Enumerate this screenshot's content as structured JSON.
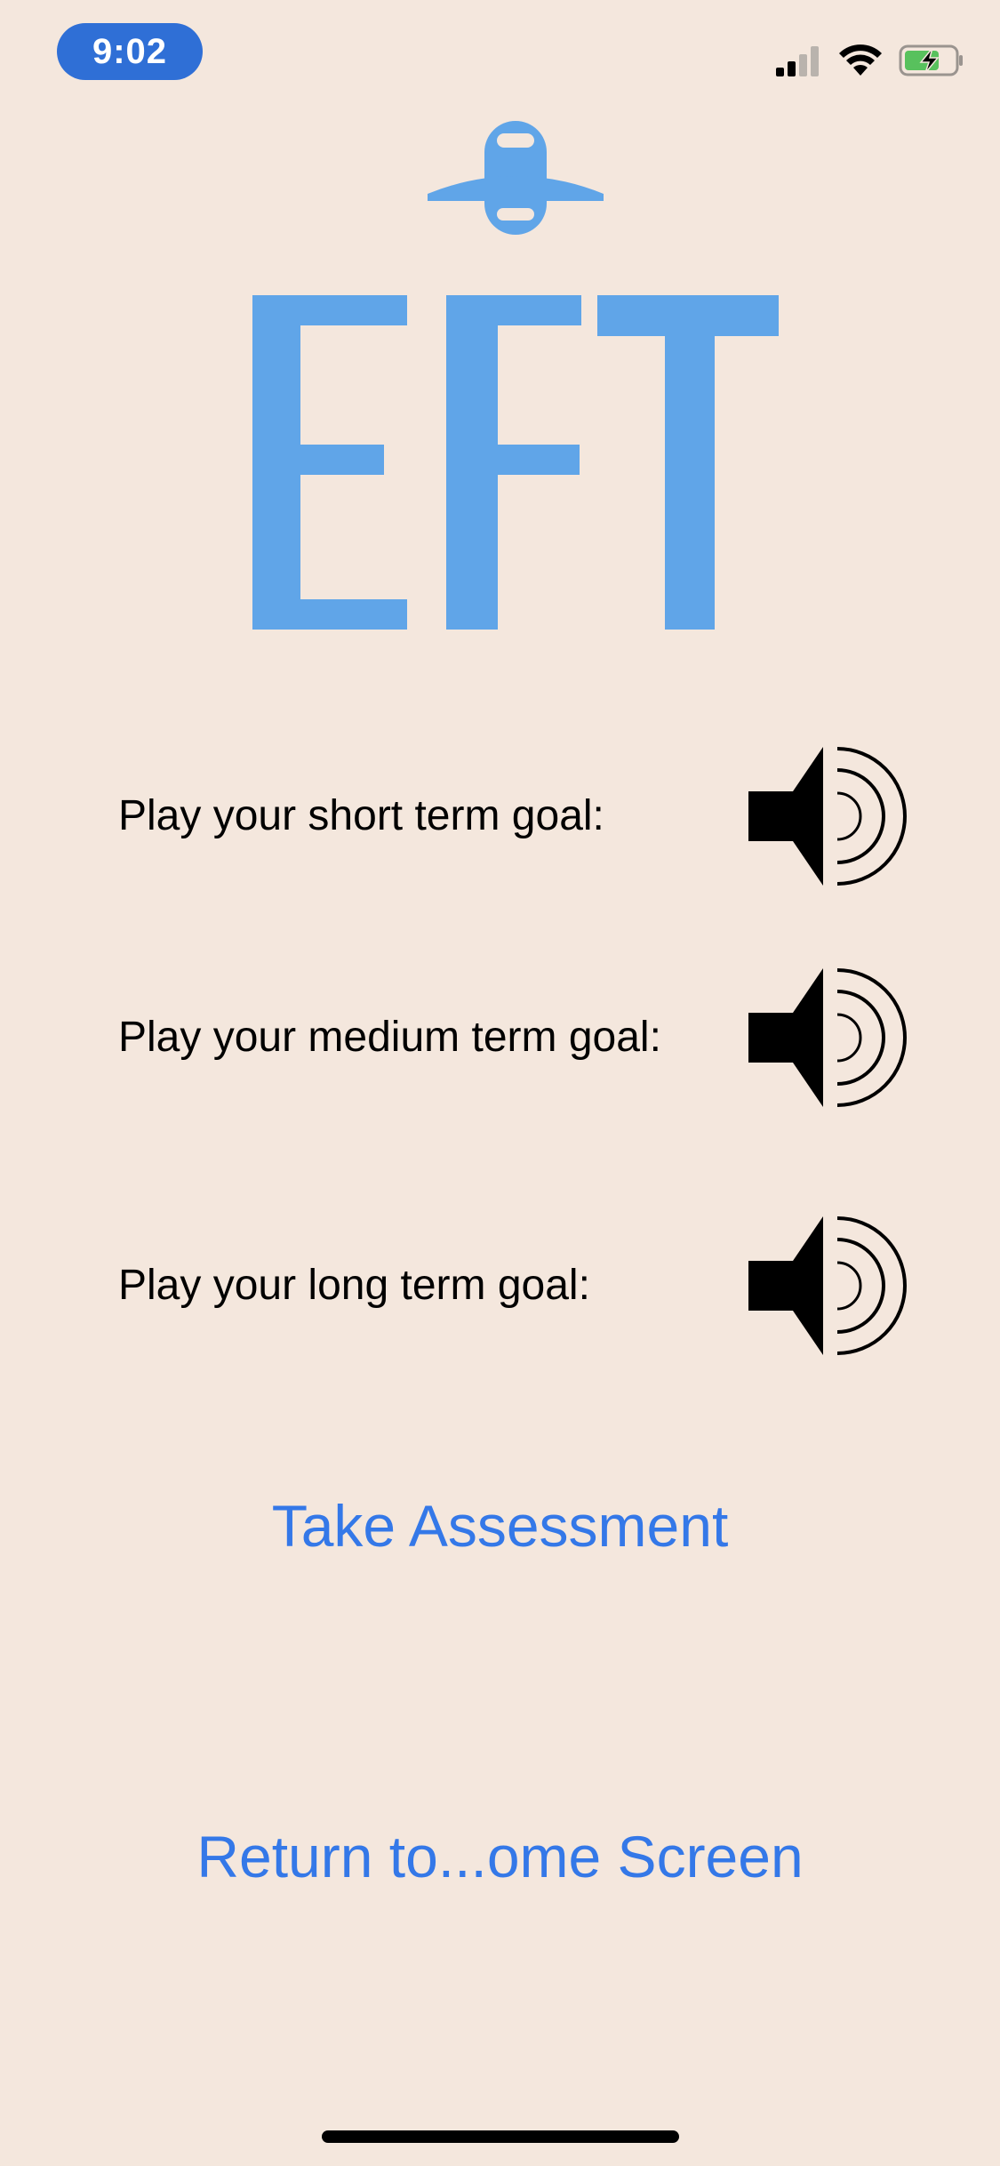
{
  "status_bar": {
    "time": "9:02",
    "icons": [
      "cellular-signal-icon",
      "wifi-icon",
      "battery-charging-icon"
    ]
  },
  "logo": {
    "icon": "plane-icon",
    "text": "EFT",
    "color": "#60a5e8"
  },
  "goals": [
    {
      "label": "Play your short term goal:",
      "icon": "speaker-icon"
    },
    {
      "label": "Play your medium term goal:",
      "icon": "speaker-icon"
    },
    {
      "label": "Play your long term goal:",
      "icon": "speaker-icon"
    }
  ],
  "actions": {
    "assessment_label": "Take Assessment",
    "return_label": "Return to...ome Screen"
  },
  "colors": {
    "background": "#f4e7dd",
    "link": "#3478e8",
    "time_pill": "#2f6fd6"
  }
}
